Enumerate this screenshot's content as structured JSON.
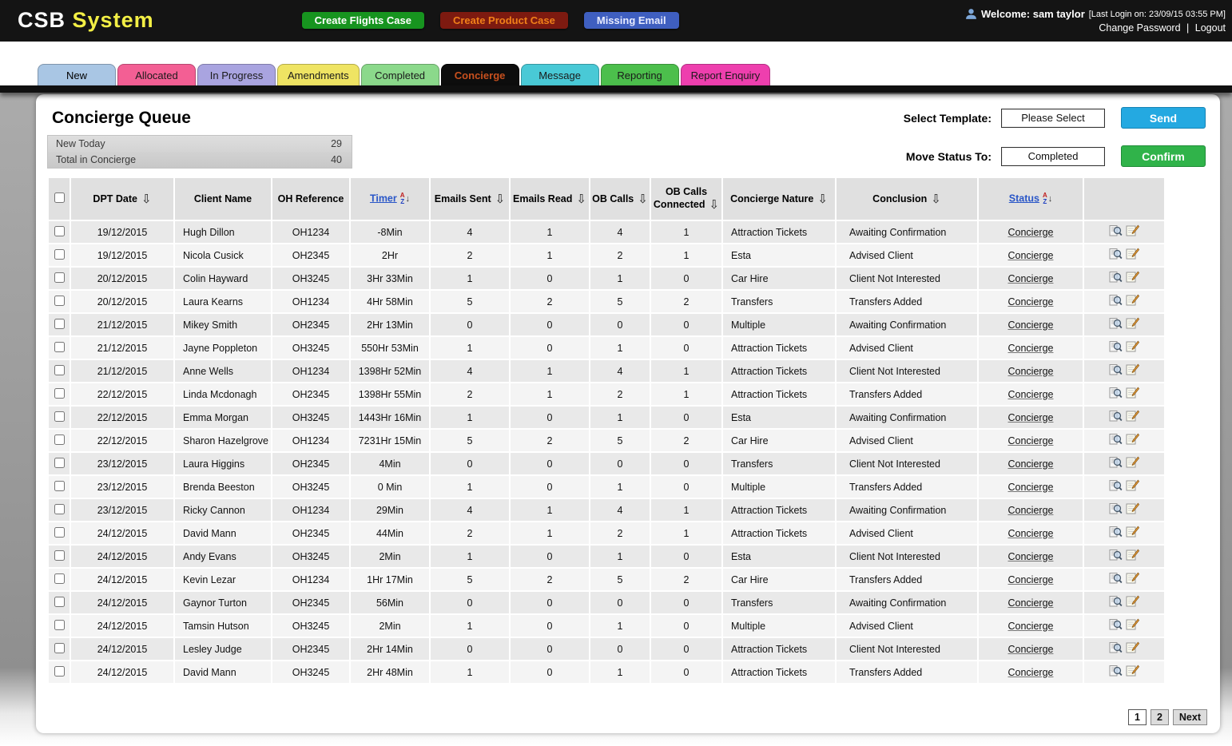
{
  "app": {
    "logo_primary": "CSB",
    "logo_secondary": "System"
  },
  "topbar": {
    "buttons": [
      {
        "label": "Create Flights Case",
        "bg": "#17941f",
        "fg": "#ffffff"
      },
      {
        "label": "Create Product Case",
        "bg": "#7d1a10",
        "fg": "#f08019"
      },
      {
        "label": "Missing Email",
        "bg": "#3f5fc0",
        "fg": "#e8ecff"
      }
    ],
    "welcome_label": "Welcome: sam taylor",
    "last_login": "[Last Login on: 23/09/15 03:55 PM]",
    "change_password": "Change Password",
    "separator": "|",
    "logout": "Logout"
  },
  "tabs": [
    {
      "label": "New",
      "bg": "#a9c6e4",
      "fg": "#000000",
      "active": false
    },
    {
      "label": "Allocated",
      "bg": "#f35f94",
      "fg": "#1a1a1a",
      "active": false
    },
    {
      "label": "In Progress",
      "bg": "#a9a4e0",
      "fg": "#1a1a1a",
      "active": false
    },
    {
      "label": "Amendments",
      "bg": "#efe463",
      "fg": "#1a1a1a",
      "active": false
    },
    {
      "label": "Completed",
      "bg": "#8bd98b",
      "fg": "#1a1a1a",
      "active": false
    },
    {
      "label": "Concierge",
      "bg": "#0d0d0d",
      "fg": "#c8501e",
      "active": true
    },
    {
      "label": "Message",
      "bg": "#49c9d6",
      "fg": "#1a1a1a",
      "active": false
    },
    {
      "label": "Reporting",
      "bg": "#4cbf4c",
      "fg": "#1a1a1a",
      "active": false
    },
    {
      "label": "Report Enquiry",
      "bg": "#ee3fae",
      "fg": "#1a1a1a",
      "active": false
    }
  ],
  "queue": {
    "title": "Concierge Queue",
    "stats": [
      {
        "label": "New Today",
        "value": "29"
      },
      {
        "label": "Total in Concierge",
        "value": "40"
      }
    ]
  },
  "controls": {
    "select_template_label": "Select Template:",
    "template_value": "Please Select",
    "send_label": "Send",
    "move_status_label": "Move Status To:",
    "status_value": "Completed",
    "confirm_label": "Confirm"
  },
  "icons": {
    "sort_down": "⇩",
    "az_a": "A",
    "az_z": "Z",
    "az_arrow": "↓"
  },
  "table": {
    "columns": {
      "dpt_date": "DPT Date",
      "client_name": "Client Name",
      "oh_reference": "OH Reference",
      "timer": "Timer",
      "emails_sent": "Emails Sent",
      "emails_read": "Emails Read",
      "ob_calls": "OB Calls",
      "ob_calls_connected": "OB Calls Connected",
      "concierge_nature": "Concierge  Nature",
      "conclusion": "Conclusion",
      "status": "Status"
    },
    "rows": [
      {
        "date": "19/12/2015",
        "client": "Hugh Dillon",
        "oh_ref": "OH1234",
        "timer": "-8Min",
        "emails_sent": "4",
        "emails_read": "1",
        "ob_calls": "4",
        "ob_calls_connected": "1",
        "nature": "Attraction Tickets",
        "conclusion": "Awaiting Confirmation",
        "status": "Concierge"
      },
      {
        "date": "19/12/2015",
        "client": "Nicola Cusick",
        "oh_ref": "OH2345",
        "timer": "2Hr",
        "emails_sent": "2",
        "emails_read": "1",
        "ob_calls": "2",
        "ob_calls_connected": "1",
        "nature": "Esta",
        "conclusion": "Advised Client",
        "status": "Concierge"
      },
      {
        "date": "20/12/2015",
        "client": "Colin Hayward",
        "oh_ref": "OH3245",
        "timer": "3Hr 33Min",
        "emails_sent": "1",
        "emails_read": "0",
        "ob_calls": "1",
        "ob_calls_connected": "0",
        "nature": "Car Hire",
        "conclusion": "Client Not Interested",
        "status": "Concierge"
      },
      {
        "date": "20/12/2015",
        "client": "Laura Kearns",
        "oh_ref": "OH1234",
        "timer": "4Hr 58Min",
        "emails_sent": "5",
        "emails_read": "2",
        "ob_calls": "5",
        "ob_calls_connected": "2",
        "nature": "Transfers",
        "conclusion": "Transfers Added",
        "status": "Concierge"
      },
      {
        "date": "21/12/2015",
        "client": "Mikey Smith",
        "oh_ref": "OH2345",
        "timer": "2Hr 13Min",
        "emails_sent": "0",
        "emails_read": "0",
        "ob_calls": "0",
        "ob_calls_connected": "0",
        "nature": "Multiple",
        "conclusion": "Awaiting Confirmation",
        "status": "Concierge"
      },
      {
        "date": "21/12/2015",
        "client": "Jayne Poppleton",
        "oh_ref": "OH3245",
        "timer": "550Hr 53Min",
        "emails_sent": "1",
        "emails_read": "0",
        "ob_calls": "1",
        "ob_calls_connected": "0",
        "nature": "Attraction Tickets",
        "conclusion": "Advised Client",
        "status": "Concierge"
      },
      {
        "date": "21/12/2015",
        "client": "Anne Wells",
        "oh_ref": "OH1234",
        "timer": "1398Hr 52Min",
        "emails_sent": "4",
        "emails_read": "1",
        "ob_calls": "4",
        "ob_calls_connected": "1",
        "nature": "Attraction Tickets",
        "conclusion": "Client Not Interested",
        "status": "Concierge"
      },
      {
        "date": "22/12/2015",
        "client": "Linda Mcdonagh",
        "oh_ref": "OH2345",
        "timer": "1398Hr 55Min",
        "emails_sent": "2",
        "emails_read": "1",
        "ob_calls": "2",
        "ob_calls_connected": "1",
        "nature": "Attraction Tickets",
        "conclusion": "Transfers Added",
        "status": "Concierge"
      },
      {
        "date": "22/12/2015",
        "client": "Emma Morgan",
        "oh_ref": "OH3245",
        "timer": "1443Hr 16Min",
        "emails_sent": "1",
        "emails_read": "0",
        "ob_calls": "1",
        "ob_calls_connected": "0",
        "nature": "Esta",
        "conclusion": "Awaiting Confirmation",
        "status": "Concierge"
      },
      {
        "date": "22/12/2015",
        "client": "Sharon Hazelgrove",
        "oh_ref": "OH1234",
        "timer": "7231Hr 15Min",
        "emails_sent": "5",
        "emails_read": "2",
        "ob_calls": "5",
        "ob_calls_connected": "2",
        "nature": "Car Hire",
        "conclusion": "Advised Client",
        "status": "Concierge"
      },
      {
        "date": "23/12/2015",
        "client": "Laura Higgins",
        "oh_ref": "OH2345",
        "timer": "4Min",
        "emails_sent": "0",
        "emails_read": "0",
        "ob_calls": "0",
        "ob_calls_connected": "0",
        "nature": "Transfers",
        "conclusion": "Client Not Interested",
        "status": "Concierge"
      },
      {
        "date": "23/12/2015",
        "client": "Brenda Beeston",
        "oh_ref": "OH3245",
        "timer": "0 Min",
        "emails_sent": "1",
        "emails_read": "0",
        "ob_calls": "1",
        "ob_calls_connected": "0",
        "nature": "Multiple",
        "conclusion": "Transfers Added",
        "status": "Concierge"
      },
      {
        "date": "23/12/2015",
        "client": "Ricky Cannon",
        "oh_ref": "OH1234",
        "timer": "29Min",
        "emails_sent": "4",
        "emails_read": "1",
        "ob_calls": "4",
        "ob_calls_connected": "1",
        "nature": "Attraction Tickets",
        "conclusion": "Awaiting Confirmation",
        "status": "Concierge"
      },
      {
        "date": "24/12/2015",
        "client": "David Mann",
        "oh_ref": "OH2345",
        "timer": "44Min",
        "emails_sent": "2",
        "emails_read": "1",
        "ob_calls": "2",
        "ob_calls_connected": "1",
        "nature": "Attraction Tickets",
        "conclusion": "Advised Client",
        "status": "Concierge"
      },
      {
        "date": "24/12/2015",
        "client": "Andy Evans",
        "oh_ref": "OH3245",
        "timer": "2Min",
        "emails_sent": "1",
        "emails_read": "0",
        "ob_calls": "1",
        "ob_calls_connected": "0",
        "nature": "Esta",
        "conclusion": "Client Not Interested",
        "status": "Concierge"
      },
      {
        "date": "24/12/2015",
        "client": "Kevin Lezar",
        "oh_ref": "OH1234",
        "timer": "1Hr 17Min",
        "emails_sent": "5",
        "emails_read": "2",
        "ob_calls": "5",
        "ob_calls_connected": "2",
        "nature": "Car Hire",
        "conclusion": "Transfers Added",
        "status": "Concierge"
      },
      {
        "date": "24/12/2015",
        "client": "Gaynor Turton",
        "oh_ref": "OH2345",
        "timer": "56Min",
        "emails_sent": "0",
        "emails_read": "0",
        "ob_calls": "0",
        "ob_calls_connected": "0",
        "nature": "Transfers",
        "conclusion": "Awaiting Confirmation",
        "status": "Concierge"
      },
      {
        "date": "24/12/2015",
        "client": "Tamsin Hutson",
        "oh_ref": "OH3245",
        "timer": "2Min",
        "emails_sent": "1",
        "emails_read": "0",
        "ob_calls": "1",
        "ob_calls_connected": "0",
        "nature": "Multiple",
        "conclusion": "Advised Client",
        "status": "Concierge"
      },
      {
        "date": "24/12/2015",
        "client": "Lesley Judge",
        "oh_ref": "OH2345",
        "timer": "2Hr 14Min",
        "emails_sent": "0",
        "emails_read": "0",
        "ob_calls": "0",
        "ob_calls_connected": "0",
        "nature": "Attraction Tickets",
        "conclusion": "Client Not Interested",
        "status": "Concierge"
      },
      {
        "date": "24/12/2015",
        "client": "David Mann",
        "oh_ref": "OH3245",
        "timer": "2Hr 48Min",
        "emails_sent": "1",
        "emails_read": "0",
        "ob_calls": "1",
        "ob_calls_connected": "0",
        "nature": "Attraction Tickets",
        "conclusion": "Transfers Added",
        "status": "Concierge"
      }
    ]
  },
  "pagination": {
    "page_1": "1",
    "page_2": "2",
    "next": "Next"
  }
}
